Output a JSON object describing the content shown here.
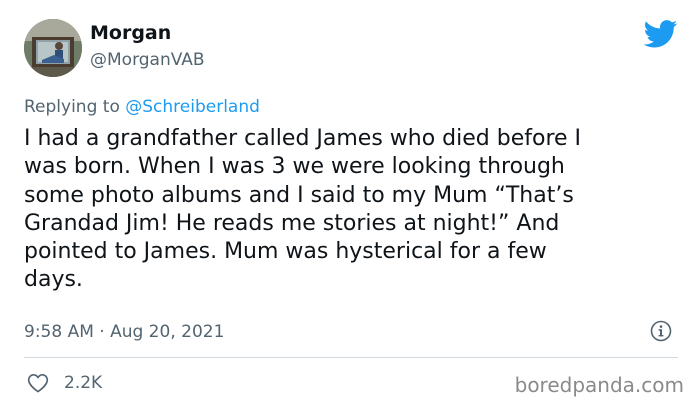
{
  "author": {
    "display_name": "Morgan",
    "handle": "@MorganVAB"
  },
  "reply": {
    "prefix": "Replying to",
    "mention": "@Schreiberland"
  },
  "tweet": {
    "text": "I had a grandfather called James who died before I\nwas born. When I was 3 we were looking through\nsome photo albums and I said to my Mum “That’s\nGrandad Jim! He reads me stories at night!” And\npointed to James. Mum was hysterical for a few\ndays.",
    "timestamp": "9:58 AM · Aug 20, 2021"
  },
  "actions": {
    "like_count": "2.2K"
  },
  "watermark": "boredpanda.com",
  "icons": {
    "brand": "twitter-bird-icon",
    "info": "info-icon",
    "like": "heart-icon"
  },
  "colors": {
    "brand_blue": "#1d9bf0",
    "text_primary": "#0f1419",
    "text_secondary": "#536471"
  }
}
